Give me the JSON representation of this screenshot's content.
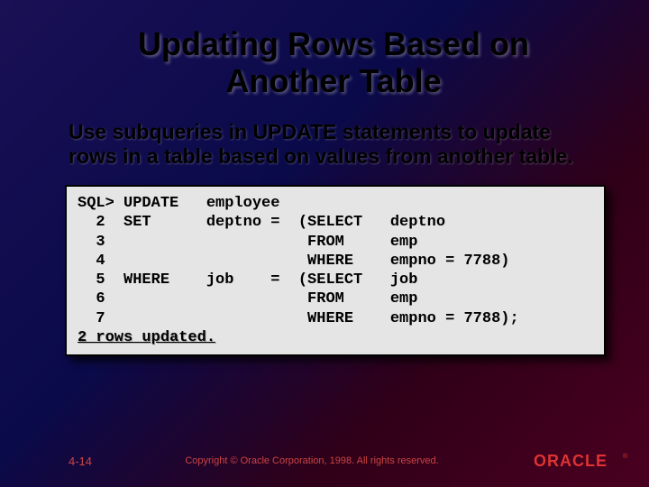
{
  "slide": {
    "title": "Updating Rows Based on Another Table",
    "subtitle": "Use subqueries in UPDATE statements to update rows in a table based on values from another table."
  },
  "code": {
    "line1": "SQL> UPDATE   employee",
    "line2": "  2  SET      deptno =  (SELECT   deptno",
    "line3": "  3                      FROM     emp",
    "line4": "  4                      WHERE    empno = 7788)",
    "line5": "  5  WHERE    job    =  (SELECT   job",
    "line6": "  6                      FROM     emp",
    "line7": "  7                      WHERE    empno = 7788);",
    "result": "2 rows updated."
  },
  "footer": {
    "page": "4-14",
    "copyright": "Copyright © Oracle Corporation, 1998. All rights reserved.",
    "logo_text": "ORACLE"
  }
}
